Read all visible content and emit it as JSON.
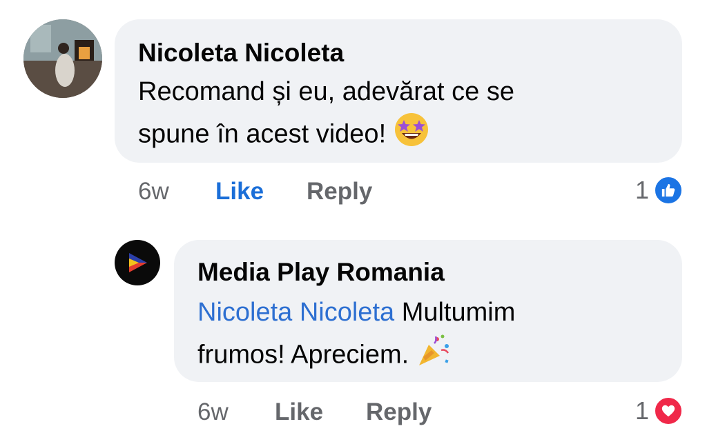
{
  "comments": [
    {
      "author": "Nicoleta Nicoleta",
      "text_line1": "Recomand și eu, adevărat ce se",
      "text_line2": "spune în acest video!",
      "emoji": "star-struck-emoji",
      "time": "6w",
      "like_label": "Like",
      "reply_label": "Reply",
      "reaction_count": "1",
      "reaction_icon": "thumbs-up-icon",
      "reaction_color": "#1b74e4"
    },
    {
      "author": "Media Play Romania",
      "mention": "Nicoleta Nicoleta",
      "text_line1_rest": "Multumim",
      "text_line2": "frumos! Apreciem.",
      "emoji": "party-popper-emoji",
      "time": "6w",
      "like_label": "Like",
      "reply_label": "Reply",
      "reaction_count": "1",
      "reaction_icon": "heart-icon",
      "reaction_color": "#f02849"
    }
  ],
  "colors": {
    "bubble": "#f0f2f5",
    "mention": "#2d6fd1",
    "like_active": "#1a6ed8",
    "meta": "#65676b"
  }
}
